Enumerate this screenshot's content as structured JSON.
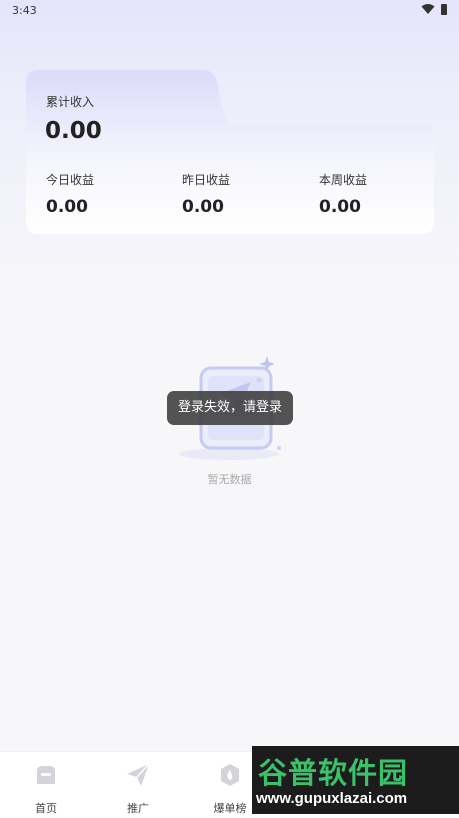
{
  "status": {
    "time": "3:43"
  },
  "income": {
    "total_label": "累计收入",
    "total_value": "0.00",
    "stats": [
      {
        "label": "今日收益",
        "value": "0.00"
      },
      {
        "label": "昨日收益",
        "value": "0.00"
      },
      {
        "label": "本周收益",
        "value": "0.00"
      }
    ]
  },
  "empty": {
    "text": "暂无数据"
  },
  "toast": {
    "text": "登录失效，请登录"
  },
  "nav": {
    "items": [
      {
        "label": "首页",
        "icon": "home-icon"
      },
      {
        "label": "推广",
        "icon": "paper-plane-icon"
      },
      {
        "label": "爆单榜",
        "icon": "flame-badge-icon"
      }
    ]
  },
  "watermark": {
    "line1": "谷普软件园",
    "line2": "www.gupuxlazai.com"
  }
}
